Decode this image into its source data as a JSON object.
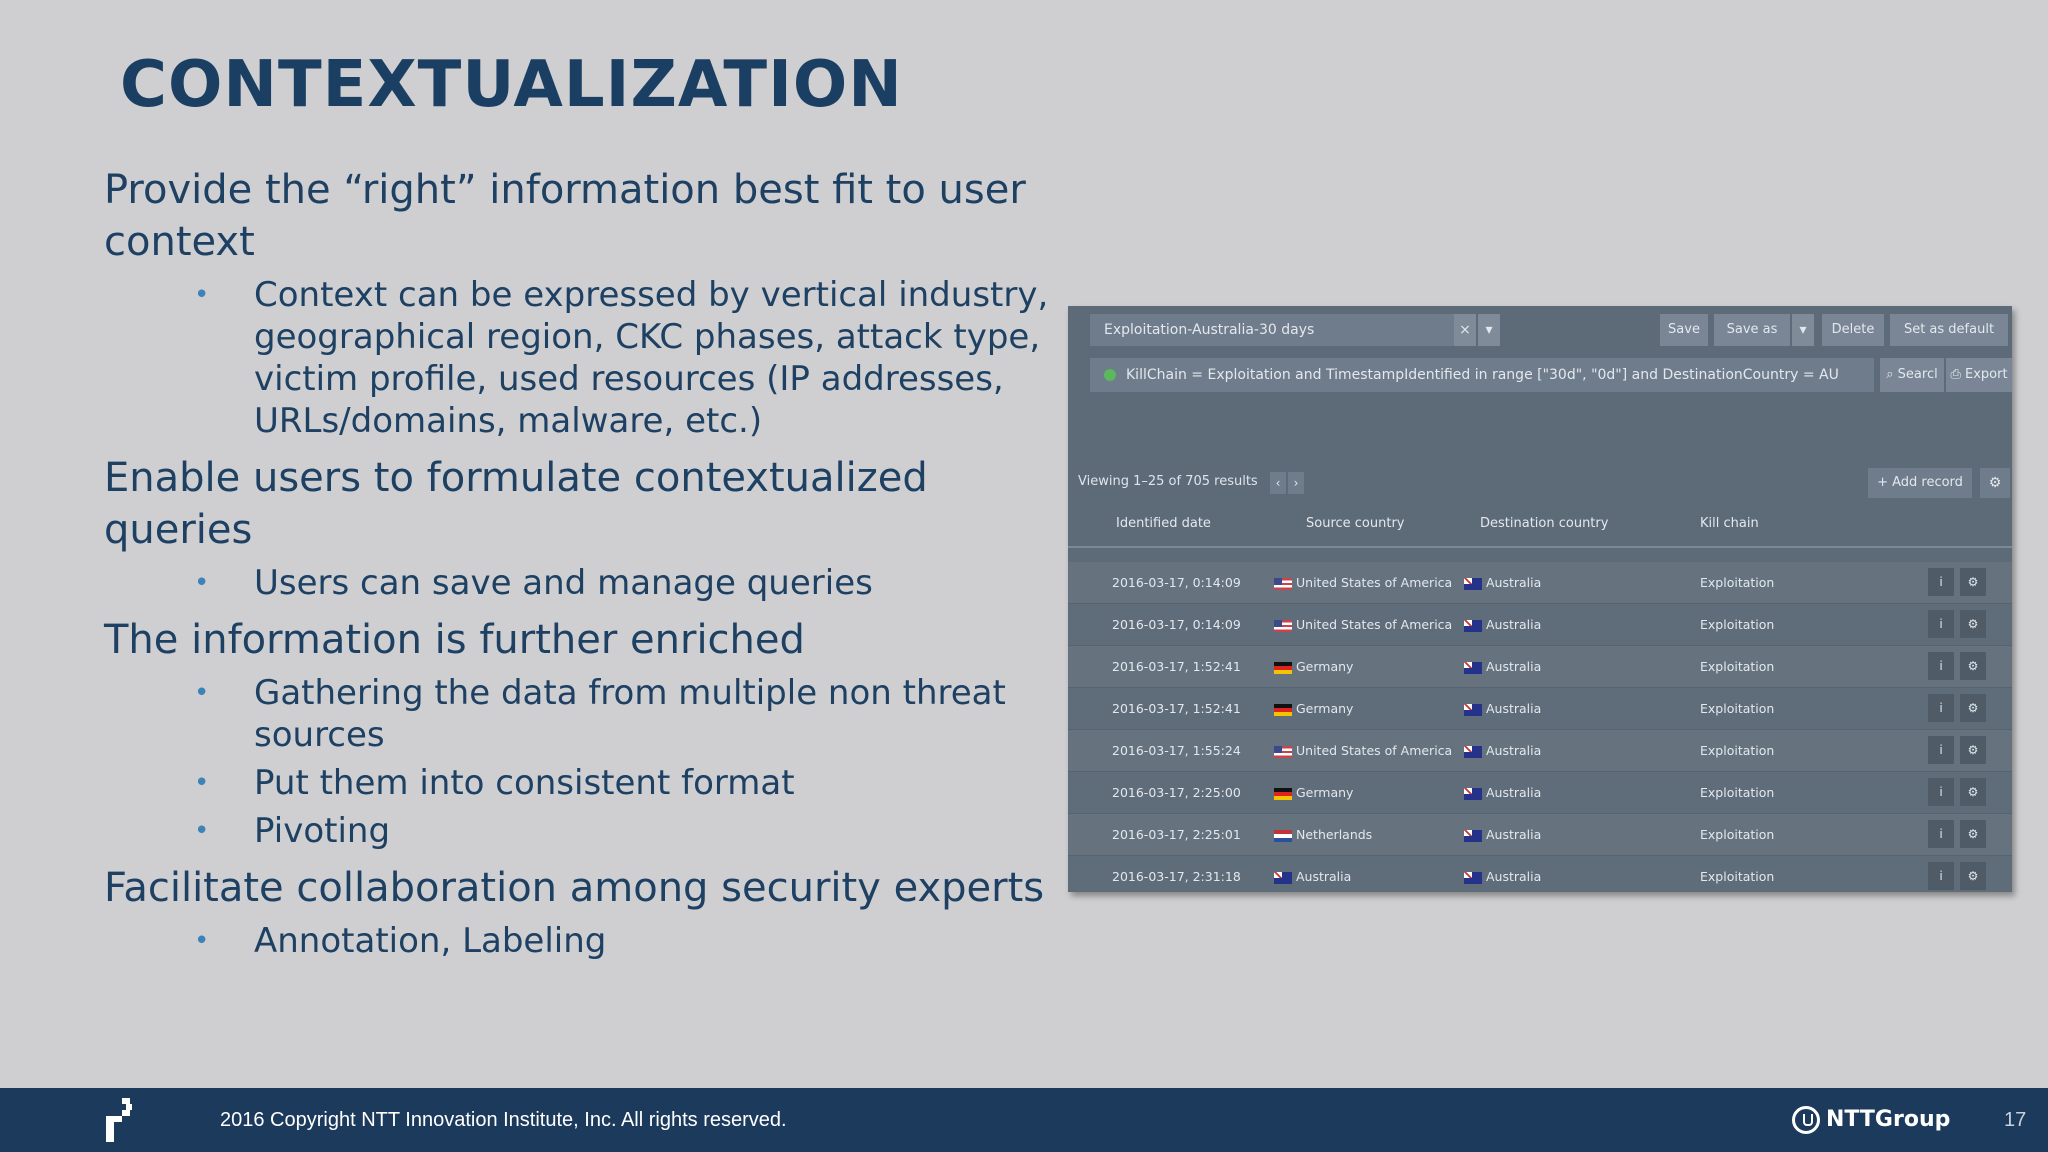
{
  "slide": {
    "title": "CONTEXTUALIZATION",
    "page_number": "17"
  },
  "content": {
    "items": [
      {
        "level": 1,
        "text": "Provide the “right” information best fit to user context"
      },
      {
        "level": 2,
        "text": "Context can be expressed by vertical industry, geographical region, CKC phases, attack type, victim profile, used resources (IP addresses, URLs/domains, malware, etc.)"
      },
      {
        "level": 1,
        "text": "Enable users to formulate contextualized queries"
      },
      {
        "level": 2,
        "text": "Users can save and manage queries"
      },
      {
        "level": 1,
        "text": "The information is further enriched"
      },
      {
        "level": 2,
        "text": "Gathering the data from multiple non threat sources"
      },
      {
        "level": 2,
        "text": "Put them into consistent format"
      },
      {
        "level": 2,
        "text": "Pivoting"
      },
      {
        "level": 1,
        "text": "Facilitate collaboration among security experts"
      },
      {
        "level": 2,
        "text": "Annotation, Labeling"
      }
    ],
    "bullet_glyph": "•"
  },
  "screenshot": {
    "query_name": "Exploitation-Australia-30 days",
    "clear_glyph": "×",
    "dropdown_glyph": "▾",
    "buttons": {
      "save": "Save",
      "save_as": "Save as",
      "delete": "Delete",
      "set_default": "Set as default",
      "search": "⌕ Searcl",
      "export": "⎙ Export",
      "add_record": "+ Add record",
      "gear": "⚙"
    },
    "filter_text": "KillChain = Exploitation and TimestampIdentified in range [\"30d\", \"0d\"] and DestinationCountry = AU",
    "viewing": "Viewing 1–25 of 705 results",
    "prev": "‹",
    "next": "›",
    "columns": {
      "date": "Identified date",
      "source": "Source country",
      "destination": "Destination country",
      "kill_chain": "Kill chain"
    },
    "rows": [
      {
        "date": "2016-03-17, 0:14:09",
        "source": "United States of America",
        "source_flag": "us",
        "destination": "Australia",
        "kill_chain": "Exploitation"
      },
      {
        "date": "2016-03-17, 0:14:09",
        "source": "United States of America",
        "source_flag": "us",
        "destination": "Australia",
        "kill_chain": "Exploitation"
      },
      {
        "date": "2016-03-17, 1:52:41",
        "source": "Germany",
        "source_flag": "de",
        "destination": "Australia",
        "kill_chain": "Exploitation"
      },
      {
        "date": "2016-03-17, 1:52:41",
        "source": "Germany",
        "source_flag": "de",
        "destination": "Australia",
        "kill_chain": "Exploitation"
      },
      {
        "date": "2016-03-17, 1:55:24",
        "source": "United States of America",
        "source_flag": "us",
        "destination": "Australia",
        "kill_chain": "Exploitation"
      },
      {
        "date": "2016-03-17, 2:25:00",
        "source": "Germany",
        "source_flag": "de",
        "destination": "Australia",
        "kill_chain": "Exploitation"
      },
      {
        "date": "2016-03-17, 2:25:01",
        "source": "Netherlands",
        "source_flag": "nl",
        "destination": "Australia",
        "kill_chain": "Exploitation"
      },
      {
        "date": "2016-03-17, 2:31:18",
        "source": "Australia",
        "source_flag": "au",
        "destination": "Australia",
        "kill_chain": "Exploitation"
      }
    ],
    "row_info_glyph": "i",
    "row_gear_glyph": "⚙"
  },
  "footer": {
    "copyright": "2016 Copyright NTT Innovation Institute, Inc. All rights reserved.",
    "brand": "NTTGroup"
  },
  "colors": {
    "background": "#cfcfd1",
    "title": "#1b3f63",
    "text": "#1d4063",
    "bullet": "#3c84b8",
    "footer": "#1c3a5c"
  }
}
